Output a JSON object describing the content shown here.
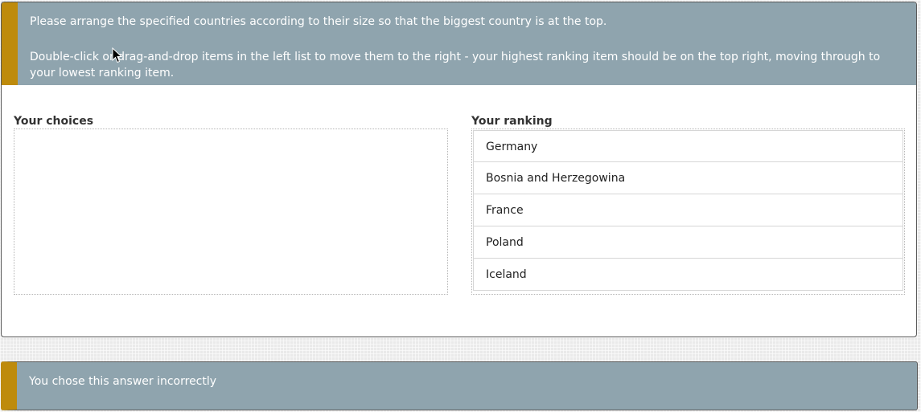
{
  "instructions": {
    "line1": "Please arrange the specified countries according to their size so that the biggest country is at the top.",
    "line2": "Double-click or drag-and-drop items in the left list to move them to the right - your highest ranking item should be on the top right, moving through to your lowest ranking item."
  },
  "choices": {
    "label": "Your choices",
    "items": []
  },
  "ranking": {
    "label": "Your ranking",
    "items": [
      {
        "label": "Germany"
      },
      {
        "label": "Bosnia and Herzegowina"
      },
      {
        "label": "France"
      },
      {
        "label": "Poland"
      },
      {
        "label": "Iceland"
      }
    ]
  },
  "feedback": {
    "text": "You chose this answer incorrectly"
  },
  "colors": {
    "accent": "#be8b0c",
    "panel": "#8fa4ae"
  }
}
